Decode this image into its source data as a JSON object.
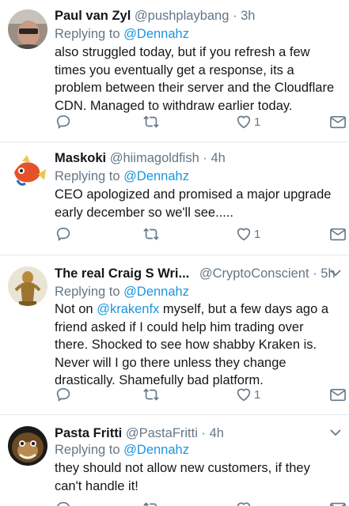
{
  "tweets": [
    {
      "name": "Paul van Zyl",
      "handle": "@pushplaybang",
      "separator": "·",
      "time": "3h",
      "replying_prefix": "Replying to",
      "replying_mention": "@Dennahz",
      "text": "also struggled today, but if you refresh a few times you eventually get a response, its a problem between their server and the Cloudflare CDN. Managed to withdraw earlier today.",
      "like_count": "1"
    },
    {
      "name": "Maskoki",
      "handle": "@hiimagoldfish",
      "separator": "·",
      "time": "4h",
      "replying_prefix": "Replying to",
      "replying_mention": "@Dennahz",
      "text": "CEO apologized and promised a major upgrade early december so we'll see.....",
      "like_count": "1"
    },
    {
      "name": "The real Craig S Wri...",
      "handle": "@CryptoConscient",
      "separator": "·",
      "time": "5h",
      "replying_prefix": "Replying to",
      "replying_mention": "@Dennahz",
      "text_before": "Not on ",
      "text_mention": "@krakenfx",
      "text_after": " myself, but a few days ago a friend asked if I could help him trading over there. Shocked to see how shabby Kraken is. Never will I go there unless they change drastically. Shamefully bad platform.",
      "like_count": "1"
    },
    {
      "name": "Pasta Fritti",
      "handle": "@PastaFritti",
      "separator": "·",
      "time": "4h",
      "replying_prefix": "Replying to",
      "replying_mention": "@Dennahz",
      "text": "they should not allow new customers, if they can't handle it!"
    }
  ],
  "icons": {
    "reply": "reply-icon",
    "retweet": "retweet-icon",
    "like": "heart-icon",
    "message": "envelope-icon",
    "more": "chevron-down-icon"
  },
  "colors": {
    "text": "#14171a",
    "muted": "#657786",
    "link": "#1b95e0",
    "divider": "#e1e8ed"
  }
}
